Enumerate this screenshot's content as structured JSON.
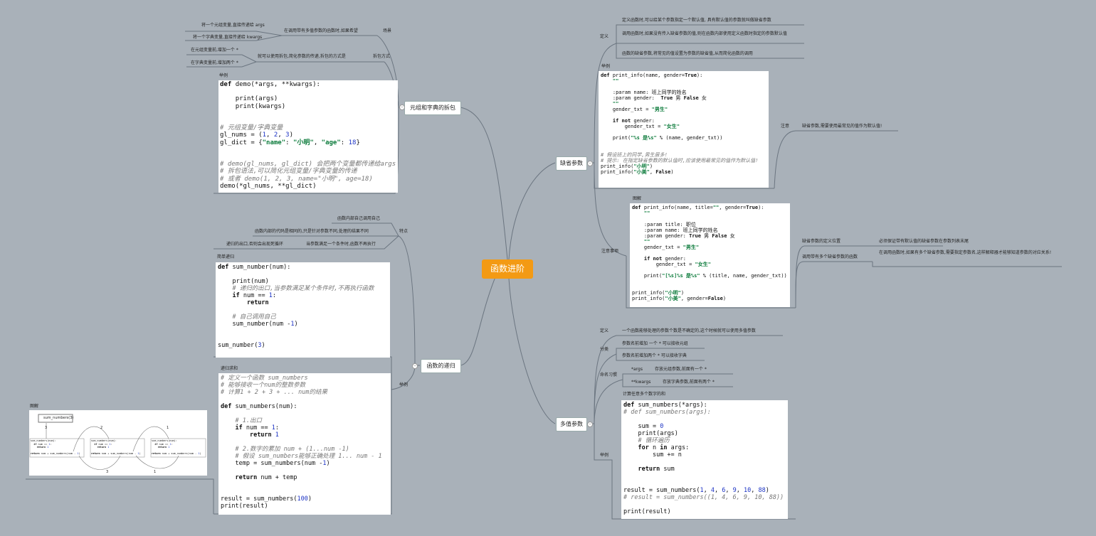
{
  "central_topic": "函数进阶",
  "branches": {
    "tuple_dict_unpack": {
      "title": "元组和字典的拆包",
      "scene_label": "场景",
      "scene_text": "在调用带有多值参数的函数时,如果希望",
      "scene_items": [
        "将一个元组变量,直接传递给 args",
        "将一个字典变量,直接传递给 kwargs"
      ],
      "method_label": "拆包方式",
      "method_text": "就可以使用拆包,简化参数的传递,拆包的方式是",
      "method_items": [
        "在元组变量前,增加一个 *",
        "在字典变量前,增加两个 *"
      ],
      "example_label": "举例",
      "code": [
        "def demo(*args, **kwargs):",
        "",
        "    print(args)",
        "    print(kwargs)",
        "",
        "",
        "# 元组变量/字典变量",
        "gl_nums = (1, 2, 3)",
        "gl_dict = {\"name\": \"小明\", \"age\": 18}",
        "",
        "",
        "# demo(gl_nums, gl_dict) 会把两个变量都传递给args",
        "# 拆包语法,可以简化元组变量/字典变量的传递",
        "# 或者 demo(1, 2, 3, name=\"小明\", age=18)",
        "demo(*gl_nums, **gl_dict)"
      ]
    },
    "recursion": {
      "title": "函数的递归",
      "feature_label": "特点",
      "features": [
        "函数内部自己调用自己",
        "函数内部的代码是相同的,只是针对参数不同,处理的结果不同",
        "当参数满足一个条件时,函数不再执行"
      ],
      "exit_text": "递归的出口,否则会出现死循环",
      "example_label": "举例",
      "simple_label": "简单递归",
      "simple_code": [
        "def sum_number(num):",
        "",
        "    print(num)",
        "    # 递归的出口,当参数满足某个条件时,不再执行函数",
        "    if num == 1:",
        "        return",
        "",
        "    # 自己调用自己",
        "    sum_number(num -1)",
        "",
        "",
        "sum_number(3)"
      ],
      "sum_label": "递归求和",
      "sum_code": [
        "# 定义一个函数 sum_numbers",
        "# 能够接收一个num的整数参数",
        "# 计算1 + 2 + 3 + ... num的结果",
        "",
        "def sum_numbers(num):",
        "",
        "    # 1.出口",
        "    if num == 1:",
        "        return 1",
        "",
        "    # 2.数字的累加 num + (1...num -1)",
        "    # 假设 sum_numbers能够正确处理 1... num - 1",
        "    temp = sum_numbers(num -1)",
        "",
        "    return num + temp",
        "",
        "",
        "result = sum_numbers(100)",
        "print(result)"
      ],
      "diagram_label": "图解",
      "diagram": {
        "top_call": "sum_numbers(3)",
        "arc_labels": [
          "3",
          "2",
          "1"
        ],
        "bottom_labels": [
          "3",
          "1"
        ],
        "boxes": [
          [
            "sum_numbers(num):",
            "  if num == 1:",
            "    return 1",
            "",
            "return num + sum_numbers(num - 1)"
          ],
          [
            "sum_numbers(num):",
            "  if num == 1:",
            "    return 1",
            "",
            "return num + sum_numbers(num - 1)"
          ],
          [
            "sum_numbers(num):",
            "  if num == 1:",
            "    return 1",
            "",
            "return num + sum_numbers(num - 1)"
          ]
        ]
      }
    },
    "default_params": {
      "title": "缺省参数",
      "def_label": "定义",
      "defs": [
        "定义函数时,可以给某个参数指定一个默认值,  具有默认值的参数就叫做缺省参数",
        "调用函数时,如果没有传入缺省参数的值,则在函数内部使用定义函数时指定的参数默认值",
        "函数的缺省参数,将常见的值设置为参数的缺省值,从而简化函数的调用"
      ],
      "example_label": "举例",
      "code": [
        "def print_info(name, gender=True):",
        "    \"\"\"",
        "",
        "    :param name: 班上同学的姓名",
        "    :param gender:  True 男 False 女",
        "    \"\"\"",
        "    gender_txt = \"男生\"",
        "",
        "    if not gender:",
        "        gender_txt = \"女生\"",
        "",
        "    print(\"%s 是%s\" % (name, gender_txt))",
        "",
        "",
        "# 假设班上的同学,男生居多!",
        "# 提示: 在指定缺省参数的默认值时,应该使用最常见的值作为默认值!",
        "print_info(\"小明\")",
        "print_info(\"小美\", False)"
      ],
      "note_label": "注意",
      "note_text": "缺省参数,需要使用最常见的值作为默认值!",
      "attention_label": "注意事项",
      "diagram_label": "图解",
      "code2": [
        "def print_info(name, title=\"\", gender=True):",
        "    \"\"\"",
        "",
        "    :param title: 职位",
        "    :param name: 班上同学的姓名",
        "    :param gender: True 男 False 女",
        "    \"\"\"",
        "    gender_txt = \"男生\"",
        "",
        "    if not gender:",
        "        gender_txt = \"女生\"",
        "",
        "    print(\"[%s]%s 是%s\" % (title, name, gender_txt))",
        "",
        "",
        "print_info(\"小明\")",
        "print_info(\"小美\", gender=False)"
      ],
      "pos_label": "缺省参数的定义位置",
      "pos_text": "必须保证带有默认值的缺省参数在参数列表末尾",
      "multi_label": "调用带有多个缺省参数的函数",
      "multi_text": "在调用函数时,如果有多个缺省参数,需要指定参数名,这样解释器才能够知道参数的对应关系!"
    },
    "var_params": {
      "title": "多值参数",
      "def_label": "定义",
      "def_text": "一个函数能够处理的参数个数是不确定的,这个时候就可以使用多值参数",
      "cat_label": "分类",
      "cats": [
        "参数名前增加 一个 * 可以接收元组",
        "参数名前增加两个 * 可以接收字典"
      ],
      "naming_label": "命名习惯",
      "naming": [
        {
          "name": "*args",
          "desc": "存放元组参数,前面有一个 *"
        },
        {
          "name": "**kwargs",
          "desc": "存放字典参数,前面有两个 *"
        }
      ],
      "example_label": "举例",
      "example_title": "计算任意多个数字的和",
      "code": [
        "def sum_numbers(*args):",
        "# def sum_numbers(args):",
        "",
        "    sum = 0",
        "    print(args)",
        "    # 循环遍历",
        "    for n in args:",
        "        sum += n",
        "",
        "    return sum",
        "",
        "",
        "result = sum_numbers(1, 4, 6, 9, 10, 88)",
        "# result = sum_numbers((1, 4, 6, 9, 10, 88))",
        "",
        "print(result)"
      ]
    }
  },
  "colors": {
    "background": "#a9b1b9",
    "central": "#f39a14",
    "line": "#6b7580"
  }
}
